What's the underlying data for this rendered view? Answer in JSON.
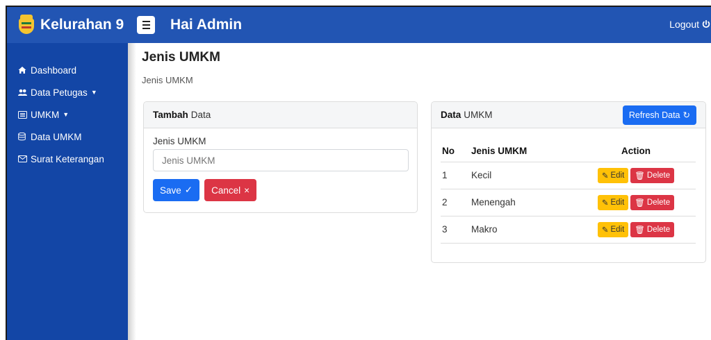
{
  "header": {
    "brand": "Kelurahan 9",
    "greeting": "Hai Admin",
    "logout_label": "Logout",
    "color": "#2255b3"
  },
  "sidebar": {
    "color": "#1346a6",
    "items": [
      {
        "label": "Dashboard",
        "icon": "home-icon"
      },
      {
        "label": "Data Petugas",
        "icon": "users-icon",
        "dropdown": true
      },
      {
        "label": "UMKM",
        "icon": "list-icon",
        "dropdown": true
      },
      {
        "label": "Data UMKM",
        "icon": "database-icon"
      },
      {
        "label": "Surat Keterangan",
        "icon": "envelope-icon"
      }
    ]
  },
  "page": {
    "title": "Jenis UMKM",
    "breadcrumb": "Jenis UMKM"
  },
  "form_card": {
    "header_bold": "Tambah",
    "header_rest": "Data",
    "field_label": "Jenis UMKM",
    "field_value": "",
    "field_placeholder": "Jenis UMKM",
    "save_label": "Save",
    "cancel_label": "Cancel"
  },
  "table_card": {
    "header_bold": "Data",
    "header_rest": "UMKM",
    "refresh_label": "Refresh Data",
    "columns": [
      "No",
      "Jenis UMKM",
      "Action"
    ],
    "rows": [
      {
        "no": "1",
        "name": "Kecil"
      },
      {
        "no": "2",
        "name": "Menengah"
      },
      {
        "no": "3",
        "name": "Makro"
      }
    ],
    "edit_label": "Edit",
    "delete_label": "Delete"
  },
  "colors": {
    "primary": "#1a6cf2",
    "danger": "#dc3545",
    "warning": "#ffc107"
  }
}
